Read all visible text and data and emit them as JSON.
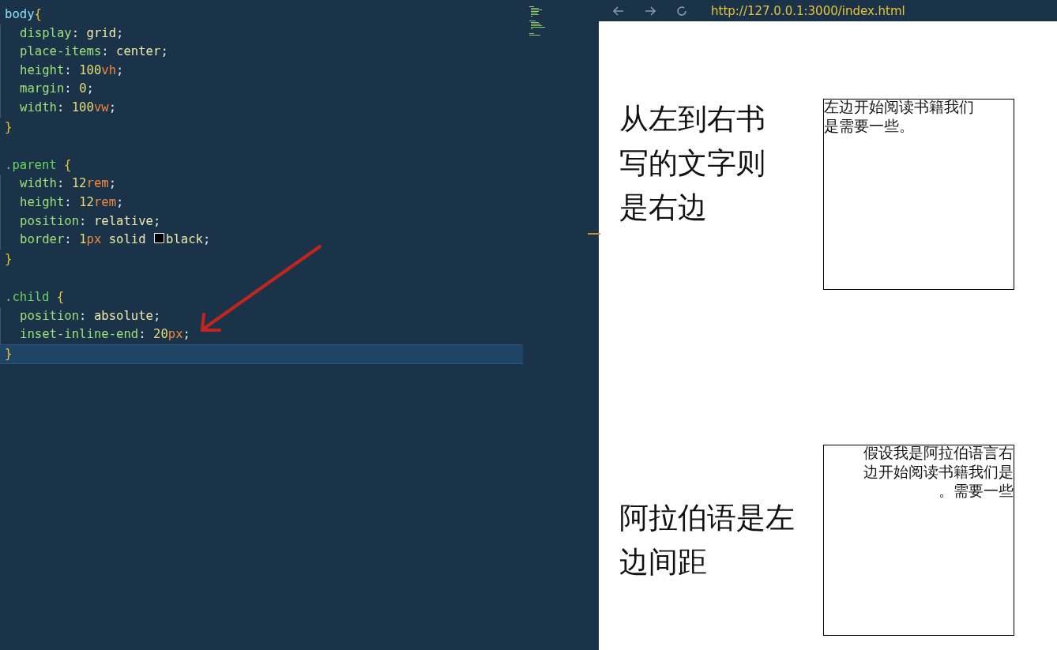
{
  "editor": {
    "rules": [
      {
        "selector": "body",
        "kind": "element",
        "open": "{",
        "close": "}",
        "cursor_on_close": false,
        "declarations": [
          {
            "property": "display",
            "colon": ":",
            "end": ";",
            "value": [
              {
                "text": "grid",
                "kind": "keyword"
              }
            ]
          },
          {
            "property": "place-items",
            "colon": ":",
            "end": ";",
            "value": [
              {
                "text": "center",
                "kind": "keyword"
              }
            ]
          },
          {
            "property": "height",
            "colon": ":",
            "end": ";",
            "value": [
              {
                "text": "100",
                "kind": "number"
              },
              {
                "text": "vh",
                "kind": "unit"
              }
            ]
          },
          {
            "property": "margin",
            "colon": ":",
            "end": ";",
            "value": [
              {
                "text": "0",
                "kind": "number"
              }
            ]
          },
          {
            "property": "width",
            "colon": ":",
            "end": ";",
            "value": [
              {
                "text": "100",
                "kind": "number"
              },
              {
                "text": "vw",
                "kind": "unit"
              }
            ]
          }
        ]
      },
      {
        "selector": ".parent",
        "kind": "class",
        "open": "{",
        "close": "}",
        "cursor_on_close": false,
        "declarations": [
          {
            "property": "width",
            "colon": ":",
            "end": ";",
            "value": [
              {
                "text": "12",
                "kind": "number"
              },
              {
                "text": "rem",
                "kind": "unit"
              }
            ]
          },
          {
            "property": "height",
            "colon": ":",
            "end": ";",
            "value": [
              {
                "text": "12",
                "kind": "number"
              },
              {
                "text": "rem",
                "kind": "unit"
              }
            ]
          },
          {
            "property": "position",
            "colon": ":",
            "end": ";",
            "value": [
              {
                "text": "relative",
                "kind": "keyword"
              }
            ]
          },
          {
            "property": "border",
            "colon": ":",
            "end": ";",
            "value": [
              {
                "text": "1",
                "kind": "number"
              },
              {
                "text": "px",
                "kind": "unit"
              },
              {
                "text": "solid",
                "kind": "keyword"
              },
              {
                "text": "black",
                "kind": "color",
                "color": "#000000"
              }
            ]
          }
        ]
      },
      {
        "selector": ".child",
        "kind": "class",
        "open": "{",
        "close": "}",
        "cursor_on_close": true,
        "declarations": [
          {
            "property": "position",
            "colon": ":",
            "end": ";",
            "value": [
              {
                "text": "absolute",
                "kind": "keyword"
              }
            ]
          },
          {
            "property": "inset-inline-end",
            "colon": ":",
            "end": ";",
            "value": [
              {
                "text": "20",
                "kind": "number"
              },
              {
                "text": "px",
                "kind": "unit"
              }
            ]
          }
        ]
      }
    ]
  },
  "browser": {
    "url": "http://127.0.0.1:3000/index.html",
    "sections": [
      {
        "heading": "从左到右书写的文字则是右边",
        "kind": "ltr",
        "box_text": "左边开始阅读书籍我们是需要一些。"
      },
      {
        "heading": "阿拉伯语是左边间距",
        "kind": "rtl",
        "box_text": "假设我是阿拉伯语言右边开始阅读书籍我们是需要一些。"
      }
    ]
  }
}
